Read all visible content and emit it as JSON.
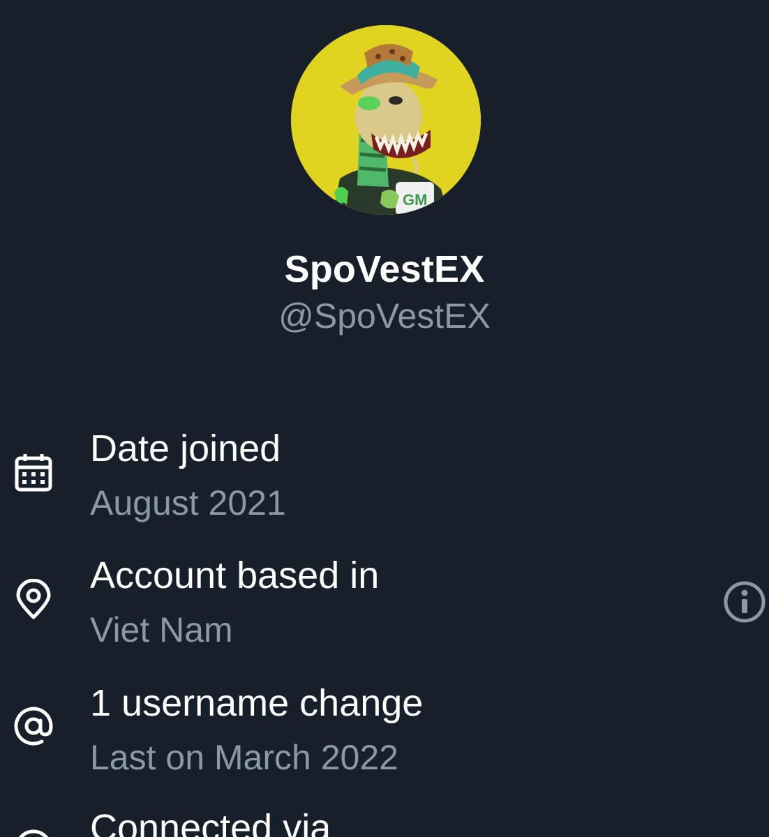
{
  "profile": {
    "display_name": "SpoVestEX",
    "handle": "@SpoVestEX",
    "avatar_icon": "profile-avatar-image",
    "avatar_bg_color": "#e0d420"
  },
  "about": {
    "items": [
      {
        "label": "Date joined",
        "value": "August 2021",
        "icon": "calendar-icon"
      },
      {
        "label": "Account based in",
        "value": "Viet Nam",
        "icon": "location-pin-icon"
      },
      {
        "label": "1 username change",
        "value": "Last on March 2022",
        "icon": "at-sign-icon"
      },
      {
        "label": "Connected via",
        "value": "",
        "icon": "connection-icon"
      }
    ],
    "info_icon": "info-icon"
  },
  "colors": {
    "background": "#17202a",
    "primary_text": "#ffffff",
    "secondary_text": "#8b98a5"
  }
}
